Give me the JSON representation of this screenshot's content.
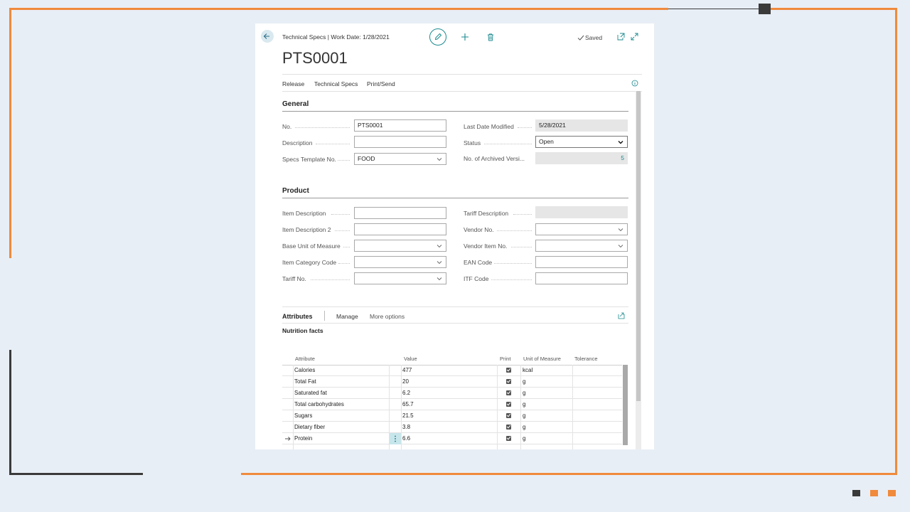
{
  "header": {
    "breadcrumb": "Technical Specs | Work Date: 1/28/2021",
    "title": "PTS0001",
    "saved_label": "Saved"
  },
  "actions": [
    "Release",
    "Technical Specs",
    "Print/Send"
  ],
  "general": {
    "heading": "General",
    "left": [
      {
        "label": "No.",
        "value": "PTS0001",
        "kind": "text"
      },
      {
        "label": "Description",
        "value": "",
        "kind": "text"
      },
      {
        "label": "Specs Template No.",
        "value": "FOOD",
        "kind": "select"
      }
    ],
    "right": [
      {
        "label": "Last Date Modified",
        "value": "5/28/2021",
        "kind": "readonly"
      },
      {
        "label": "Status",
        "value": "Open",
        "kind": "select"
      },
      {
        "label": "No. of Archived Versi...",
        "value": "5",
        "kind": "readonly-number"
      }
    ]
  },
  "product": {
    "heading": "Product",
    "left": [
      {
        "label": "Item Description",
        "value": "",
        "kind": "text"
      },
      {
        "label": "Item Description 2",
        "value": "",
        "kind": "text"
      },
      {
        "label": "Base Unit of Measure",
        "value": "",
        "kind": "select"
      },
      {
        "label": "Item Category Code",
        "value": "",
        "kind": "select"
      },
      {
        "label": "Tariff No.",
        "value": "",
        "kind": "select"
      }
    ],
    "right": [
      {
        "label": "Tariff Description",
        "value": "",
        "kind": "readonly"
      },
      {
        "label": "Vendor No.",
        "value": "",
        "kind": "select"
      },
      {
        "label": "Vendor Item No.",
        "value": "",
        "kind": "select"
      },
      {
        "label": "EAN Code",
        "value": "",
        "kind": "text"
      },
      {
        "label": "ITF Code",
        "value": "",
        "kind": "text"
      }
    ]
  },
  "attributes": {
    "tab": "Attributes",
    "manage": "Manage",
    "more": "More options",
    "group_title": "Nutrition facts",
    "columns": [
      "Attribute",
      "Value",
      "Print",
      "Unit of Measure",
      "Tolerance"
    ],
    "rows": [
      {
        "attribute": "Calories",
        "value": "477",
        "print": true,
        "uom": "kcal",
        "tolerance": ""
      },
      {
        "attribute": "Total Fat",
        "value": "20",
        "print": true,
        "uom": "g",
        "tolerance": ""
      },
      {
        "attribute": "Saturated fat",
        "value": "6.2",
        "print": true,
        "uom": "g",
        "tolerance": ""
      },
      {
        "attribute": "Total carbohydrates",
        "value": "65.7",
        "print": true,
        "uom": "g",
        "tolerance": ""
      },
      {
        "attribute": "Sugars",
        "value": "21.5",
        "print": true,
        "uom": "g",
        "tolerance": ""
      },
      {
        "attribute": "Dietary fiber",
        "value": "3.8",
        "print": true,
        "uom": "g",
        "tolerance": ""
      },
      {
        "attribute": "Protein",
        "value": "6.6",
        "print": true,
        "uom": "g",
        "tolerance": "",
        "current": true
      }
    ]
  },
  "colors": {
    "accent": "#f08a3c",
    "teal": "#1a8a8f",
    "dark": "#3a3a3a"
  }
}
